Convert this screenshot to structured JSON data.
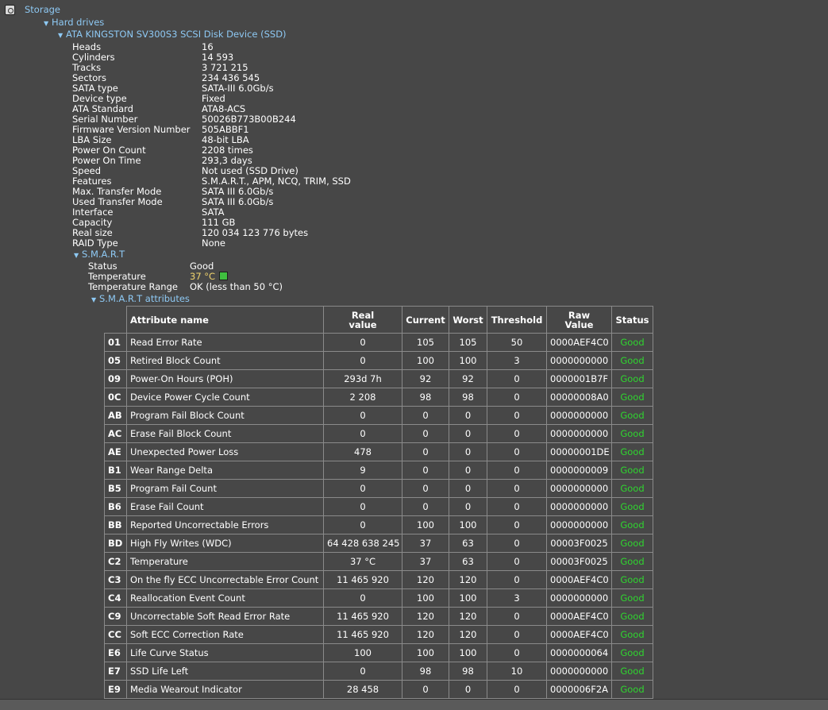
{
  "tree": {
    "storage": "Storage",
    "hard_drives": "Hard drives",
    "disk": "ATA KINGSTON SV300S3 SCSI Disk Device (SSD)",
    "smart": "S.M.A.R.T",
    "smart_attrs": "S.M.A.R.T attributes"
  },
  "properties": [
    {
      "key": "Heads",
      "value": "16"
    },
    {
      "key": "Cylinders",
      "value": "14 593"
    },
    {
      "key": "Tracks",
      "value": "3 721 215"
    },
    {
      "key": "Sectors",
      "value": "234 436 545"
    },
    {
      "key": "SATA type",
      "value": "SATA-III 6.0Gb/s"
    },
    {
      "key": "Device type",
      "value": "Fixed"
    },
    {
      "key": "ATA Standard",
      "value": "ATA8-ACS"
    },
    {
      "key": "Serial Number",
      "value": "50026B773B00B244"
    },
    {
      "key": "Firmware Version Number",
      "value": "505ABBF1"
    },
    {
      "key": "LBA Size",
      "value": "48-bit LBA"
    },
    {
      "key": "Power On Count",
      "value": "2208 times"
    },
    {
      "key": "Power On Time",
      "value": "293,3 days"
    },
    {
      "key": "Speed",
      "value": "Not used (SSD Drive)"
    },
    {
      "key": "Features",
      "value": "S.M.A.R.T., APM, NCQ, TRIM, SSD"
    },
    {
      "key": "Max. Transfer Mode",
      "value": "SATA III 6.0Gb/s"
    },
    {
      "key": "Used Transfer Mode",
      "value": "SATA III 6.0Gb/s"
    },
    {
      "key": "Interface",
      "value": "SATA"
    },
    {
      "key": "Capacity",
      "value": "111 GB"
    },
    {
      "key": "Real size",
      "value": "120 034 123 776 bytes"
    },
    {
      "key": "RAID Type",
      "value": "None"
    }
  ],
  "smart_info": {
    "status_label": "Status",
    "status_value": "Good",
    "temp_label": "Temperature",
    "temp_value": "37 °C",
    "range_label": "Temperature Range",
    "range_value": "OK (less than 50 °C)"
  },
  "table": {
    "headers": {
      "name": "Attribute name",
      "real_1": "Real",
      "real_2": "value",
      "current": "Current",
      "worst": "Worst",
      "threshold": "Threshold",
      "raw_1": "Raw",
      "raw_2": "Value",
      "status": "Status"
    },
    "rows": [
      [
        "01",
        "Read Error Rate",
        "0",
        "105",
        "105",
        "50",
        "0000AEF4C0",
        "Good"
      ],
      [
        "05",
        "Retired Block Count",
        "0",
        "100",
        "100",
        "3",
        "0000000000",
        "Good"
      ],
      [
        "09",
        "Power-On Hours (POH)",
        "293d 7h",
        "92",
        "92",
        "0",
        "0000001B7F",
        "Good"
      ],
      [
        "0C",
        "Device Power Cycle Count",
        "2 208",
        "98",
        "98",
        "0",
        "00000008A0",
        "Good"
      ],
      [
        "AB",
        "Program Fail Block Count",
        "0",
        "0",
        "0",
        "0",
        "0000000000",
        "Good"
      ],
      [
        "AC",
        "Erase Fail Block Count",
        "0",
        "0",
        "0",
        "0",
        "0000000000",
        "Good"
      ],
      [
        "AE",
        "Unexpected Power Loss",
        "478",
        "0",
        "0",
        "0",
        "00000001DE",
        "Good"
      ],
      [
        "B1",
        "Wear Range Delta",
        "9",
        "0",
        "0",
        "0",
        "0000000009",
        "Good"
      ],
      [
        "B5",
        "Program Fail Count",
        "0",
        "0",
        "0",
        "0",
        "0000000000",
        "Good"
      ],
      [
        "B6",
        "Erase Fail Count",
        "0",
        "0",
        "0",
        "0",
        "0000000000",
        "Good"
      ],
      [
        "BB",
        "Reported Uncorrectable Errors",
        "0",
        "100",
        "100",
        "0",
        "0000000000",
        "Good"
      ],
      [
        "BD",
        "High Fly Writes (WDC)",
        "64 428 638 245",
        "37",
        "63",
        "0",
        "00003F0025",
        "Good"
      ],
      [
        "C2",
        "Temperature",
        "37 °C",
        "37",
        "63",
        "0",
        "00003F0025",
        "Good"
      ],
      [
        "C3",
        "On the fly ECC Uncorrectable Error Count",
        "11 465 920",
        "120",
        "120",
        "0",
        "0000AEF4C0",
        "Good"
      ],
      [
        "C4",
        "Reallocation Event Count",
        "0",
        "100",
        "100",
        "3",
        "0000000000",
        "Good"
      ],
      [
        "C9",
        "Uncorrectable Soft Read Error Rate",
        "11 465 920",
        "120",
        "120",
        "0",
        "0000AEF4C0",
        "Good"
      ],
      [
        "CC",
        "Soft ECC Correction Rate",
        "11 465 920",
        "120",
        "120",
        "0",
        "0000AEF4C0",
        "Good"
      ],
      [
        "E6",
        "Life Curve Status",
        "100",
        "100",
        "100",
        "0",
        "0000000064",
        "Good"
      ],
      [
        "E7",
        "SSD Life Left",
        "0",
        "98",
        "98",
        "10",
        "0000000000",
        "Good"
      ],
      [
        "E9",
        "Media Wearout Indicator",
        "28 458",
        "0",
        "0",
        "0",
        "0000006F2A",
        "Good"
      ]
    ]
  },
  "colors": {
    "background": "#474747",
    "link": "#8ec9f4",
    "good": "#2fd52f",
    "temperature": "#f0d36c"
  }
}
